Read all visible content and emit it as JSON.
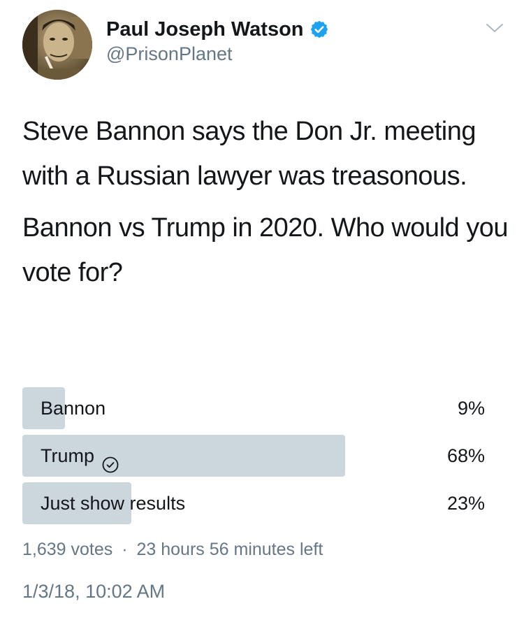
{
  "user": {
    "display_name": "Paul Joseph Watson",
    "handle": "@PrisonPlanet",
    "verified": true,
    "avatar_icon": "user-avatar-photo",
    "verified_icon": "verified-badge-icon",
    "verified_color": "#1da1f2"
  },
  "menu": {
    "chevron_icon": "chevron-down-icon"
  },
  "tweet": {
    "paragraph_1": "Steve Bannon says the Don Jr. meeting with a Russian lawyer was treasonous.",
    "paragraph_2": "Bannon vs Trump in 2020. Who would you vote for?"
  },
  "poll": {
    "options": [
      {
        "label": "Bannon",
        "percent_text": "9%",
        "percent": 9,
        "selected": false
      },
      {
        "label": "Trump",
        "percent_text": "68%",
        "percent": 68,
        "selected": true
      },
      {
        "label": "Just show results",
        "percent_text": "23%",
        "percent": 23,
        "selected": false
      }
    ],
    "selected_icon": "check-circle-icon",
    "bar_color": "#ccd6dd",
    "votes_text": "1,639 votes",
    "separator": "·",
    "time_left": "23 hours 56 minutes left"
  },
  "timestamp": "1/3/18, 10:02 AM",
  "colors": {
    "text_primary": "#14171a",
    "text_secondary": "#657786"
  }
}
